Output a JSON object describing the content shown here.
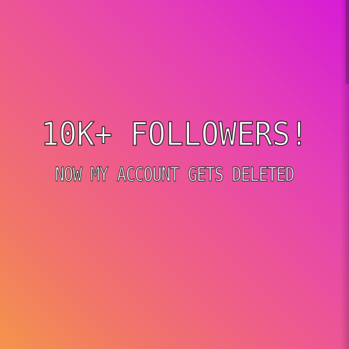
{
  "story": {
    "headline": "10K+ FOLLOWERS!",
    "subline": "NOW MY ACCOUNT GETS DELETED"
  },
  "colors": {
    "gradient_top_right": "#d61bd6",
    "gradient_middle": "#ee5a8e",
    "gradient_bottom_left": "#f4944c",
    "text": "#ffffff",
    "text_outline": "#1b1b1b"
  }
}
